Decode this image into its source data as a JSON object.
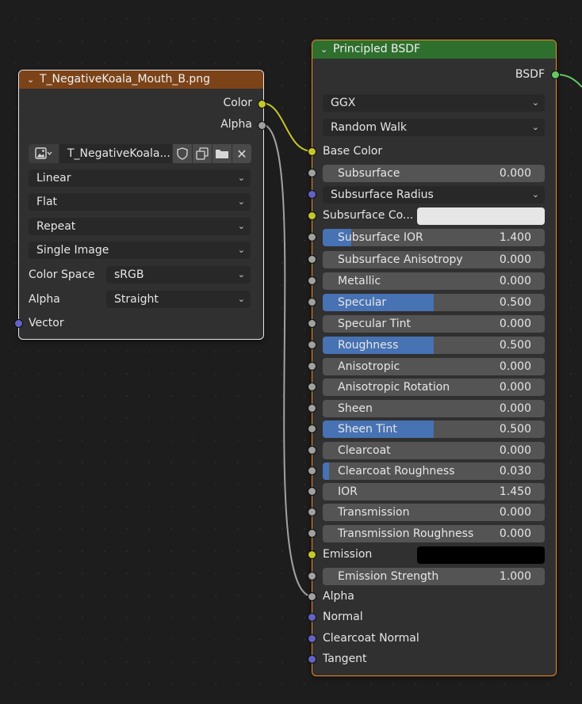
{
  "image_node": {
    "title": "T_NegativeKoala_Mouth_B.png",
    "header_color": "#7c4318",
    "outputs": [
      "Color",
      "Alpha"
    ],
    "image_name": "T_NegativeKoala...",
    "interpolation": "Linear",
    "projection": "Flat",
    "extension": "Repeat",
    "source": "Single Image",
    "color_space_label": "Color Space",
    "color_space": "sRGB",
    "alpha_label": "Alpha",
    "alpha_mode": "Straight",
    "input": "Vector"
  },
  "bsdf_node": {
    "title": "Principled BSDF",
    "header_color": "#2e6f2d",
    "output": "BSDF",
    "distribution": "GGX",
    "subsurface_method": "Random Walk",
    "base_color_label": "Base Color",
    "subsurface": {
      "label": "Subsurface",
      "value": "0.000",
      "fraction": 0
    },
    "subsurface_radius_label": "Subsurface Radius",
    "subsurface_color_label": "Subsurface Co...",
    "subsurface_color": "#e6e6e6",
    "subsurface_ior": {
      "label": "Subsurface IOR",
      "value": "1.400",
      "fraction": 0.13
    },
    "subsurface_anisotropy": {
      "label": "Subsurface Anisotropy",
      "value": "0.000",
      "fraction": 0
    },
    "metallic": {
      "label": "Metallic",
      "value": "0.000",
      "fraction": 0
    },
    "specular": {
      "label": "Specular",
      "value": "0.500",
      "fraction": 0.5
    },
    "specular_tint": {
      "label": "Specular Tint",
      "value": "0.000",
      "fraction": 0
    },
    "roughness": {
      "label": "Roughness",
      "value": "0.500",
      "fraction": 0.5
    },
    "anisotropic": {
      "label": "Anisotropic",
      "value": "0.000",
      "fraction": 0
    },
    "anisotropic_rotation": {
      "label": "Anisotropic Rotation",
      "value": "0.000",
      "fraction": 0
    },
    "sheen": {
      "label": "Sheen",
      "value": "0.000",
      "fraction": 0
    },
    "sheen_tint": {
      "label": "Sheen Tint",
      "value": "0.500",
      "fraction": 0.5
    },
    "clearcoat": {
      "label": "Clearcoat",
      "value": "0.000",
      "fraction": 0
    },
    "clearcoat_roughness": {
      "label": "Clearcoat Roughness",
      "value": "0.030",
      "fraction": 0.03
    },
    "ior": {
      "label": "IOR",
      "value": "1.450",
      "fraction": 0
    },
    "transmission": {
      "label": "Transmission",
      "value": "0.000",
      "fraction": 0
    },
    "transmission_roughness": {
      "label": "Transmission Roughness",
      "value": "0.000",
      "fraction": 0
    },
    "emission_label": "Emission",
    "emission_color": "#000000",
    "emission_strength": {
      "label": "Emission Strength",
      "value": "1.000",
      "fraction": 0
    },
    "alpha_label": "Alpha",
    "normal_label": "Normal",
    "clearcoat_normal_label": "Clearcoat Normal",
    "tangent_label": "Tangent"
  },
  "colors": {
    "canvas": "#1d1d1d",
    "node_body": "#303030",
    "selected_outline": "#f08a24",
    "slider_fill": "#4772b3",
    "socket_color": "#c7c729",
    "socket_float": "#a1a1a1",
    "socket_vector": "#6363c7",
    "socket_shader": "#63c763"
  }
}
